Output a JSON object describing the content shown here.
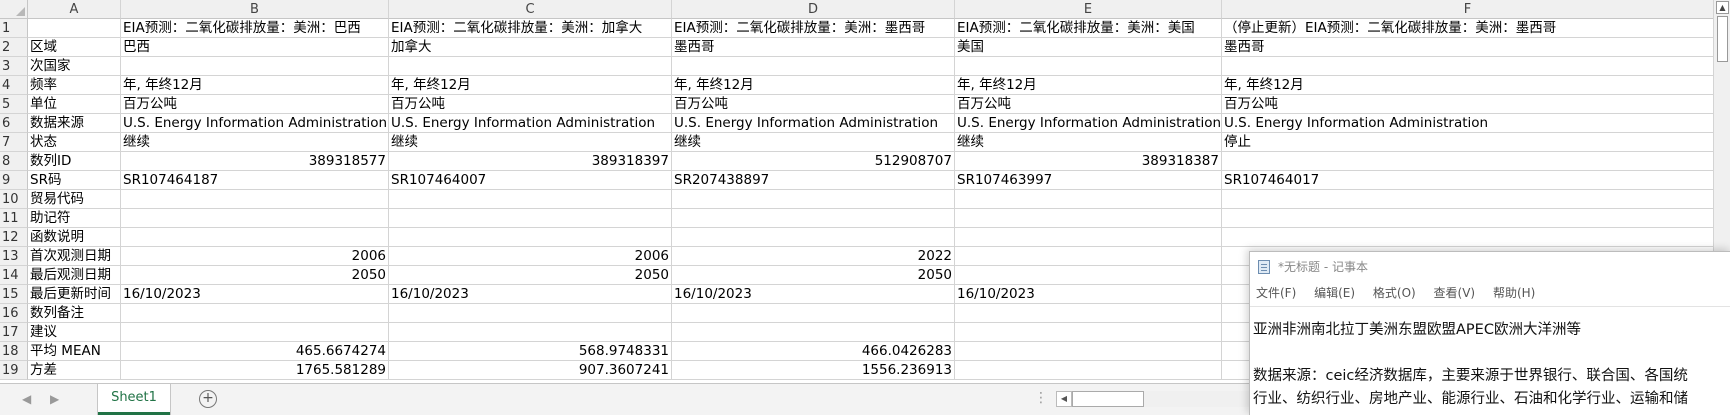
{
  "columns": [
    "A",
    "B",
    "C",
    "D",
    "E",
    "F"
  ],
  "rows": [
    {
      "num": "1",
      "a": "",
      "b": "EIA预测：二氧化碳排放量：美洲：巴西",
      "c": "EIA预测：二氧化碳排放量：美洲：加拿大",
      "d": "EIA预测：二氧化碳排放量：美洲：墨西哥",
      "e": "EIA预测：二氧化碳排放量：美洲：美国",
      "f": "（停止更新）EIA预测：二氧化碳排放量：美洲：墨西哥"
    },
    {
      "num": "2",
      "a": "区域",
      "b": "巴西",
      "c": "加拿大",
      "d": "墨西哥",
      "e": "美国",
      "f": "墨西哥"
    },
    {
      "num": "3",
      "a": "次国家",
      "b": "",
      "c": "",
      "d": "",
      "e": "",
      "f": ""
    },
    {
      "num": "4",
      "a": "频率",
      "b": "年, 年终12月",
      "c": "年, 年终12月",
      "d": "年, 年终12月",
      "e": "年, 年终12月",
      "f": "年, 年终12月"
    },
    {
      "num": "5",
      "a": "单位",
      "b": "百万公吨",
      "c": "百万公吨",
      "d": "百万公吨",
      "e": "百万公吨",
      "f": "百万公吨"
    },
    {
      "num": "6",
      "a": "数据来源",
      "b": "U.S. Energy Information Administration",
      "c": "U.S. Energy Information Administration",
      "d": "U.S. Energy Information Administration",
      "e": "U.S. Energy Information Administration",
      "f": "U.S. Energy Information Administration"
    },
    {
      "num": "7",
      "a": "状态",
      "b": "继续",
      "c": "继续",
      "d": "继续",
      "e": "继续",
      "f": "停止"
    },
    {
      "num": "8",
      "a": "数列ID",
      "b": "389318577",
      "c": "389318397",
      "d": "512908707",
      "e": "389318387",
      "f": ""
    },
    {
      "num": "9",
      "a": "SR码",
      "b": "SR107464187",
      "c": "SR107464007",
      "d": "SR207438897",
      "e": "SR107463997",
      "f": "SR107464017"
    },
    {
      "num": "10",
      "a": "贸易代码",
      "b": "",
      "c": "",
      "d": "",
      "e": "",
      "f": ""
    },
    {
      "num": "11",
      "a": "助记符",
      "b": "",
      "c": "",
      "d": "",
      "e": "",
      "f": ""
    },
    {
      "num": "12",
      "a": "函数说明",
      "b": "",
      "c": "",
      "d": "",
      "e": "",
      "f": ""
    },
    {
      "num": "13",
      "a": "首次观测日期",
      "b": "2006",
      "c": "2006",
      "d": "2022",
      "e": "",
      "f": ""
    },
    {
      "num": "14",
      "a": "最后观测日期",
      "b": "2050",
      "c": "2050",
      "d": "2050",
      "e": "",
      "f": ""
    },
    {
      "num": "15",
      "a": "最后更新时间",
      "b": "16/10/2023",
      "c": "16/10/2023",
      "d": "16/10/2023",
      "e": "16/10/2023",
      "f": ""
    },
    {
      "num": "16",
      "a": "数列备注",
      "b": "",
      "c": "",
      "d": "",
      "e": "",
      "f": ""
    },
    {
      "num": "17",
      "a": "建议",
      "b": "",
      "c": "",
      "d": "",
      "e": "",
      "f": ""
    },
    {
      "num": "18",
      "a": "平均 MEAN",
      "b": "465.6674274",
      "c": "568.9748331",
      "d": "466.0426283",
      "e": "",
      "f": ""
    },
    {
      "num": "19",
      "a": "方差",
      "b": "1765.581289",
      "c": "907.3607241",
      "d": "1556.236913",
      "e": "",
      "f": ""
    }
  ],
  "sheet_tabs": [
    "Sheet1"
  ],
  "add_sheet_glyph": "+",
  "nav_prev": "◀",
  "nav_next": "▶",
  "more_glyph": "⋮",
  "scroll_left_glyph": "◀",
  "scroll_up_glyph": "▲",
  "notepad": {
    "title": "*无标题 - 记事本",
    "menu": [
      "文件(F)",
      "编辑(E)",
      "格式(O)",
      "查看(V)",
      "帮助(H)"
    ],
    "lines": [
      "亚洲非洲南北拉丁美洲东盟欧盟APEC欧洲大洋洲等",
      "",
      "数据来源：ceic经济数据库，主要来源于世界银行、联合国、各国统",
      "行业、纺织行业、房地产业、能源行业、石油和化学行业、运输和储"
    ]
  }
}
